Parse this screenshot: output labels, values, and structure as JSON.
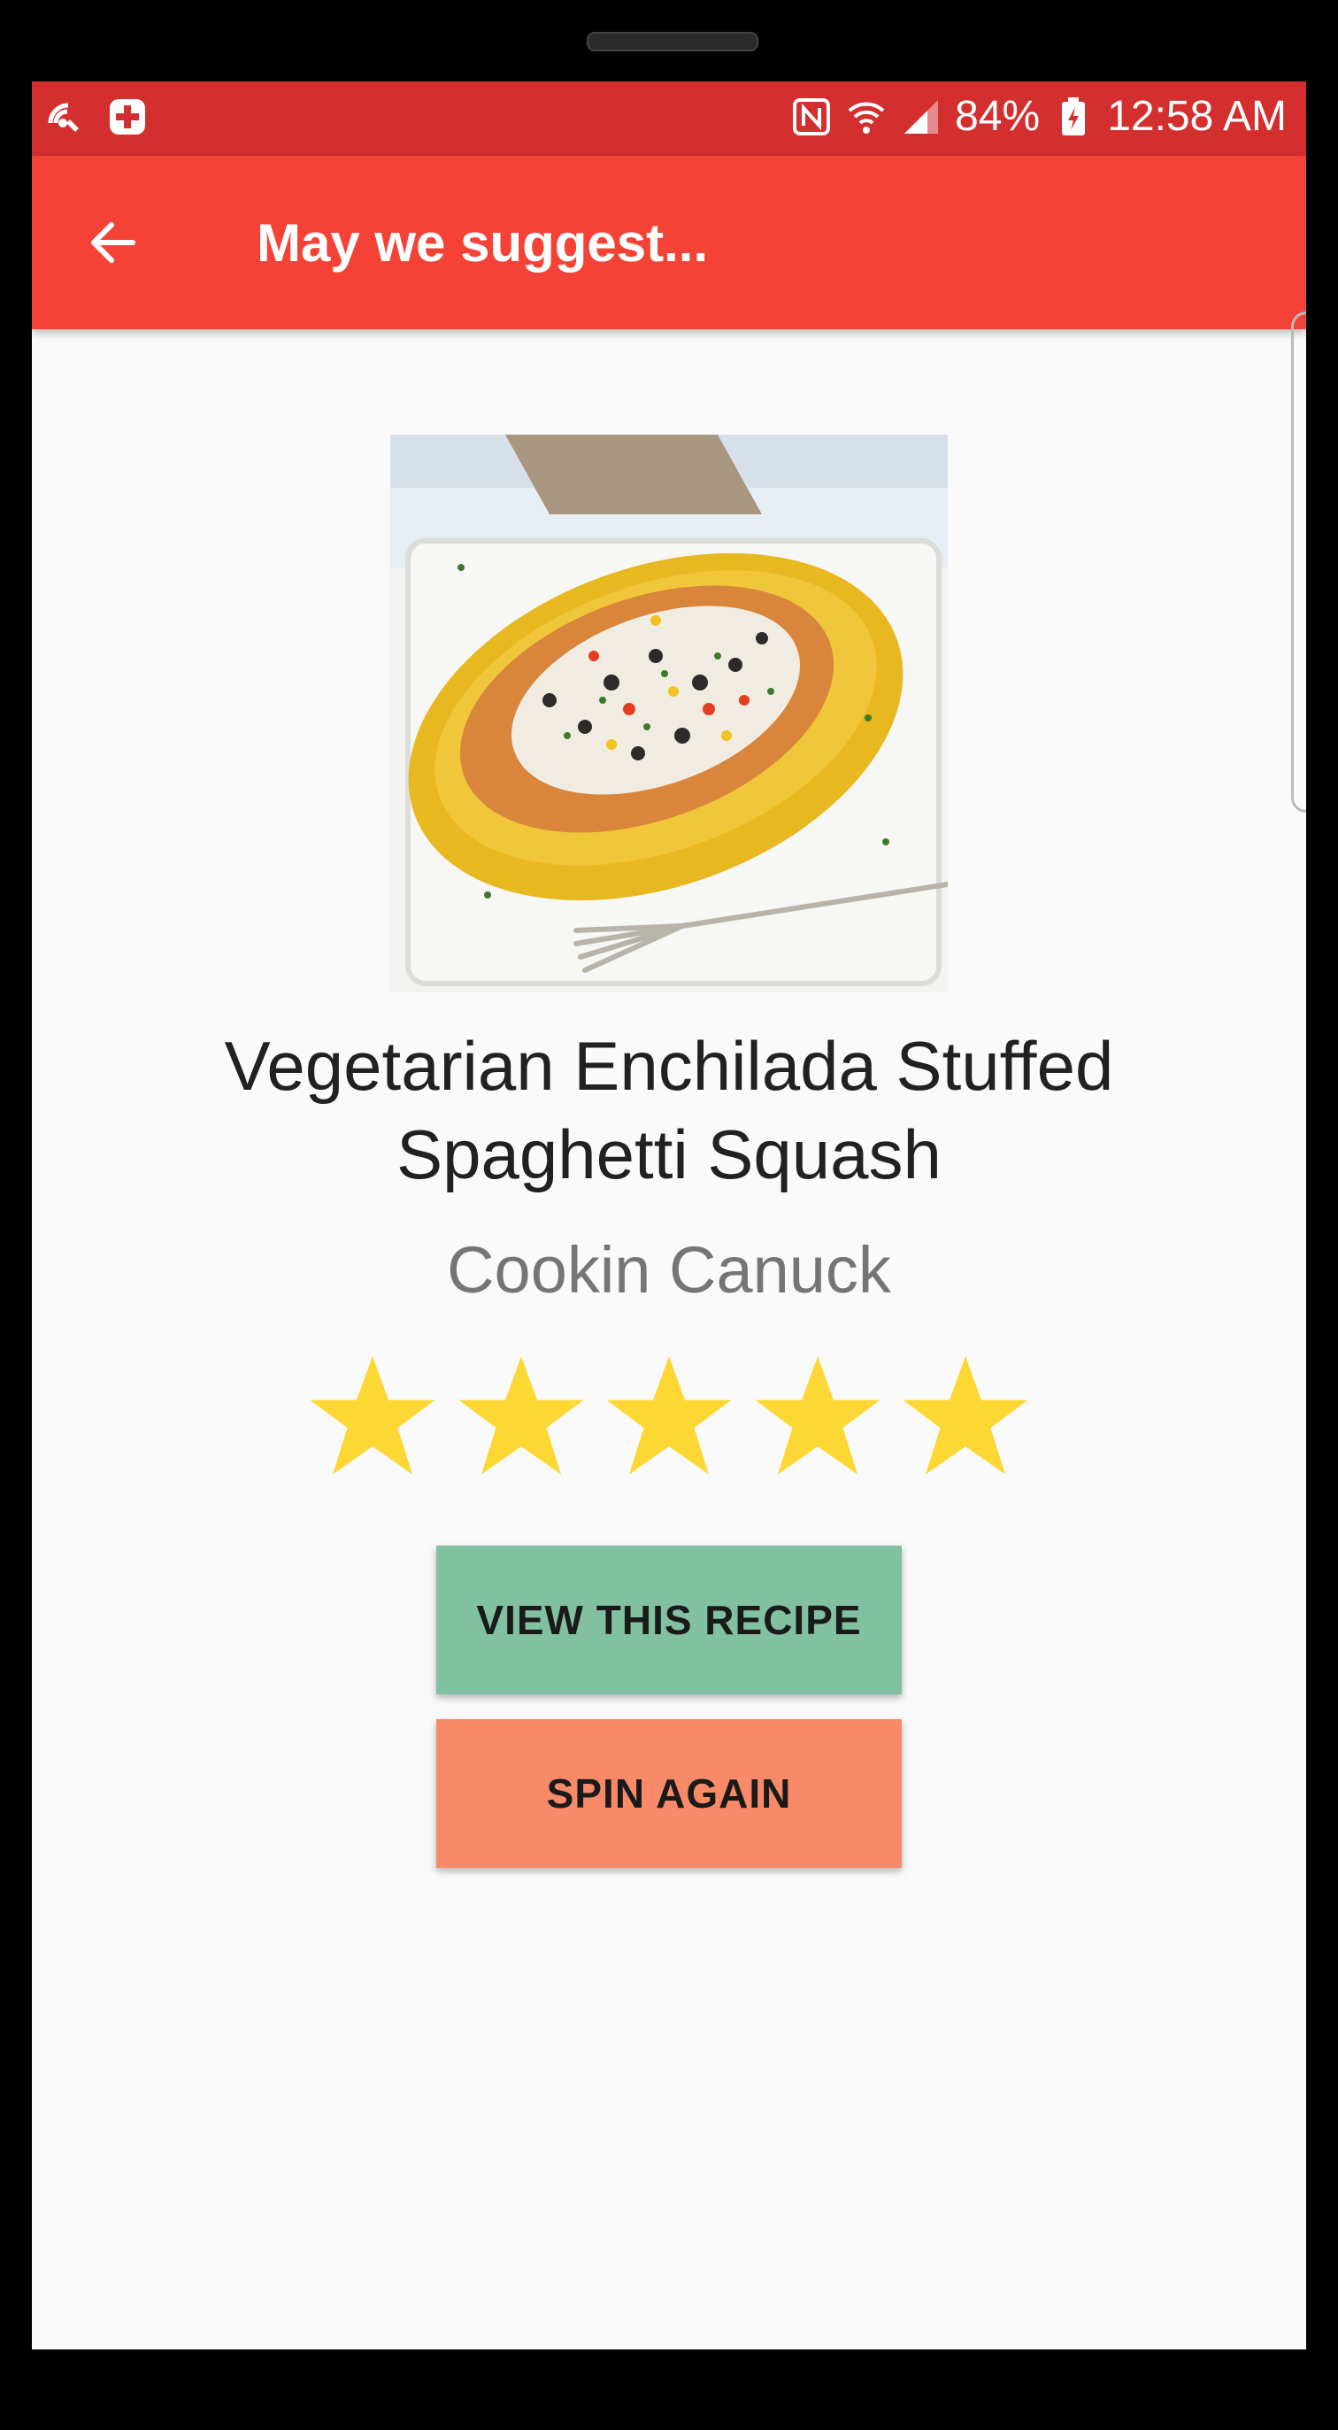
{
  "status_bar": {
    "left_icons": [
      "wifi-call-icon",
      "health-plus-icon"
    ],
    "right_icons": [
      "nfc-icon",
      "wifi-icon",
      "signal-icon"
    ],
    "battery_percent": "84%",
    "battery_icon": "battery-charging-icon",
    "time": "12:58 AM"
  },
  "app_bar": {
    "back_icon": "arrow-back-icon",
    "title": "May we suggest..."
  },
  "recipe": {
    "image_subject": "spaghetti squash boat with enchilada filling",
    "title": "Vegetarian Enchilada Stuffed Spaghetti Squash",
    "author": "Cookin Canuck",
    "rating": 5,
    "rating_max": 5
  },
  "actions": {
    "view_label": "VIEW THIS RECIPE",
    "spin_label": "SPIN AGAIN"
  },
  "colors": {
    "status_bar": "#d32f2f",
    "app_bar": "#f44336",
    "star": "#fdd835",
    "view_button": "#81c0a0",
    "spin_button": "#f88a69"
  }
}
